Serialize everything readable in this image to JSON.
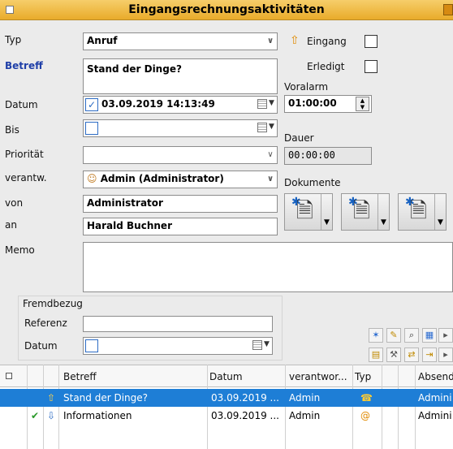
{
  "window": {
    "title": "Eingangsrechnungsaktivitäten"
  },
  "form": {
    "typ": {
      "label": "Typ",
      "value": "Anruf"
    },
    "betreff": {
      "label": "Betreff",
      "value": "Stand der Dinge?"
    },
    "eingang_label": "Eingang",
    "erledigt_label": "Erledigt",
    "voralarm": {
      "label": "Voralarm",
      "value": "01:00:00"
    },
    "datum": {
      "label": "Datum",
      "value": "03.09.2019 14:13:49"
    },
    "bis": {
      "label": "Bis",
      "value": ""
    },
    "dauer": {
      "label": "Dauer",
      "value": "00:00:00"
    },
    "prioritaet": {
      "label": "Priorität",
      "value": ""
    },
    "verantw": {
      "label": "verantw.",
      "value": "Admin (Administrator)"
    },
    "dokumente_label": "Dokumente",
    "von": {
      "label": "von",
      "value": "Administrator"
    },
    "an": {
      "label": "an",
      "value": "Harald Buchner"
    },
    "memo": {
      "label": "Memo",
      "value": ""
    },
    "fremdbezug": {
      "label": "Fremdbezug",
      "referenz_label": "Referenz",
      "referenz_value": "",
      "datum_label": "Datum",
      "datum_value": ""
    }
  },
  "grid": {
    "columns": [
      "Betreff",
      "Datum",
      "verantwor...",
      "Typ",
      "Absend"
    ],
    "rows": [
      {
        "betreff": "Stand der Dinge?",
        "datum": "03.09.2019 ...",
        "verantw": "Admin",
        "absender": "Admini",
        "direction": "up-arrow-icon",
        "type_icon": "phone-icon",
        "selected": true,
        "done": false
      },
      {
        "betreff": "Informationen",
        "datum": "03.09.2019 ...",
        "verantw": "Admin",
        "absender": "Admini",
        "direction": "down-arrow-icon",
        "type_icon": "email-at-icon",
        "selected": false,
        "done": true
      }
    ]
  },
  "colors": {
    "title_bar": "#efbd48",
    "label_blue": "#1f3fa8",
    "selection": "#1e7ed6"
  }
}
